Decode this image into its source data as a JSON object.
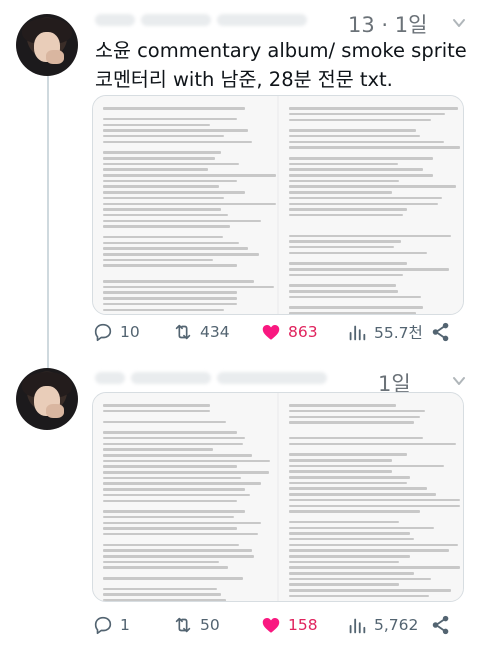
{
  "tweets": [
    {
      "date": "13 · 1일",
      "text_lines": [
        "소윤 commentary album/ smoke sprite",
        "코멘터리 with 남준, 28분 전문 txt."
      ],
      "stats": {
        "replies": "10",
        "retweets": "434",
        "likes": "863",
        "views": "55.7천"
      }
    },
    {
      "date": "1일",
      "text_lines": [],
      "stats": {
        "replies": "1",
        "retweets": "50",
        "likes": "158",
        "views": "5,762"
      }
    }
  ],
  "icons": {
    "reply": "reply-icon",
    "retweet": "retweet-icon",
    "like": "heart-icon",
    "views": "views-icon",
    "share": "share-icon",
    "more": "chevron-down-icon"
  },
  "colors": {
    "like": "#e0245e",
    "muted": "#536471",
    "retweet": "#536471"
  }
}
